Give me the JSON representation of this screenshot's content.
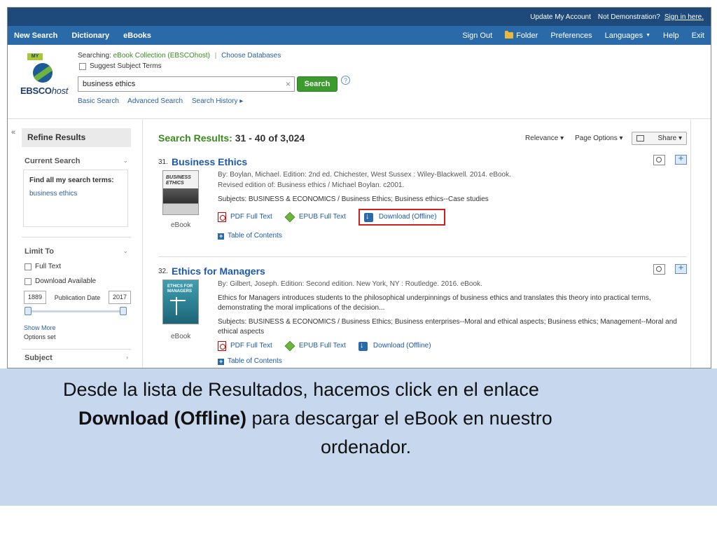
{
  "topbar": {
    "update_account": "Update My Account",
    "not_demo": "Not Demonstration?",
    "sign_in": "Sign in here."
  },
  "nav": {
    "left": [
      "New Search",
      "Dictionary",
      "eBooks"
    ],
    "sign_out": "Sign Out",
    "folder": "Folder",
    "preferences": "Preferences",
    "languages": "Languages",
    "help": "Help",
    "exit": "Exit"
  },
  "logo": {
    "my": "MY",
    "brand": "EBSCO",
    "brand_italic": "host"
  },
  "search": {
    "searching_label": "Searching:",
    "collection": "eBook Collection (EBSCOhost)",
    "choose_db": "Choose Databases",
    "suggest_label": "Suggest Subject Terms",
    "query": "business ethics",
    "clear": "×",
    "button": "Search",
    "help": "?",
    "links": [
      "Basic Search",
      "Advanced Search",
      "Search History ▸"
    ]
  },
  "sidebar": {
    "collapse": "«",
    "refine_title": "Refine Results",
    "current_search": "Current Search",
    "find_label": "Find all my search terms:",
    "find_value": "business ethics",
    "limit_to": "Limit To",
    "full_text": "Full Text",
    "download_available": "Download Available",
    "year_from": "1889",
    "pub_date_label": "Publication Date",
    "year_to": "2017",
    "show_more": "Show More",
    "options_set": "Options set",
    "subject": "Subject",
    "chev_down": "⌄",
    "chev_right": "›"
  },
  "results": {
    "title_prefix": "Search Results:",
    "range": "31 - 40 of 3,024",
    "relevance": "Relevance ▾",
    "page_options": "Page Options ▾",
    "share": "Share ▾",
    "items": [
      {
        "num": "31.",
        "title": "Business Ethics",
        "byline": "By: Boylan, Michael. Edition: 2nd ed. Chichester, West Sussex : Wiley-Blackwell. 2014. eBook.",
        "revised": "Revised edition of: Business ethics / Michael Boylan. c2001.",
        "subjects": "Subjects: BUSINESS & ECONOMICS / Business Ethics; Business ethics--Case studies",
        "cover_title": "BUSINESS ETHICS",
        "cover_label": "eBook",
        "pdf": "PDF Full Text",
        "epub": "EPUB Full Text",
        "download": "Download (Offline)",
        "toc": "Table of Contents"
      },
      {
        "num": "32.",
        "title": "Ethics for Managers",
        "byline": "By: Gilbert, Joseph. Edition: Second edition. New York, NY : Routledge. 2016. eBook.",
        "summary": "Ethics for Managers introduces students to the philosophical underpinnings of business ethics and translates this theory into practical terms, demonstrating the moral implications of the decision...",
        "subjects": "Subjects: BUSINESS & ECONOMICS / Business Ethics; Business enterprises--Moral and ethical aspects; Business ethics; Management--Moral and ethical aspects",
        "cover_title": "ETHICS FOR MANAGERS",
        "cover_label": "eBook",
        "pdf": "PDF Full Text",
        "epub": "EPUB Full Text",
        "download": "Download (Offline)",
        "toc": "Table of Contents"
      }
    ]
  },
  "caption": {
    "line1": "Desde la lista de Resultados, hacemos click en el enlace",
    "bold": "Download (Offline)",
    "line2_rest": " para descargar el eBook en nuestro",
    "line3": "ordenador."
  }
}
